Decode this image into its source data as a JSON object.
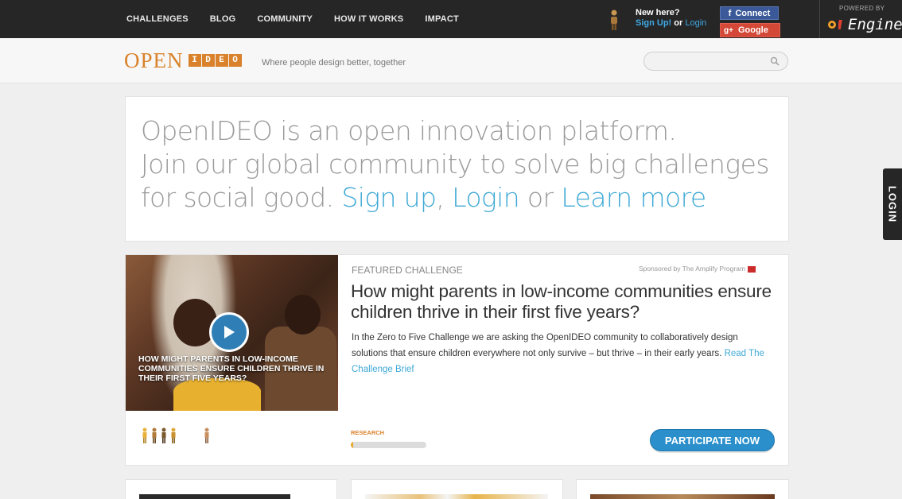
{
  "topnav": {
    "items": [
      "CHALLENGES",
      "BLOG",
      "COMMUNITY",
      "HOW IT WORKS",
      "IMPACT"
    ]
  },
  "account": {
    "new_here": "New here?",
    "signup": "Sign Up!",
    "or": "or",
    "login": "Login",
    "facebook": "Connect",
    "google": "Google"
  },
  "powered": {
    "label": "POWERED BY",
    "engine": "Engine"
  },
  "header": {
    "logo_open": "OPEN",
    "logo_ideo": [
      "I",
      "D",
      "E",
      "O"
    ],
    "tagline": "Where people design better, together",
    "search_placeholder": ""
  },
  "side_tab": {
    "label": "LOGIN"
  },
  "intro": {
    "line1": "OpenIDEO is an open innovation platform.",
    "line2": "Join our global community to solve big challenges",
    "line3_prefix": "for social good. ",
    "signup": "Sign up",
    "comma": ", ",
    "login": "Login",
    "or": " or ",
    "learn_more": "Learn more"
  },
  "featured": {
    "label": "FEATURED CHALLENGE",
    "sponsor": "Sponsored by The Amplify Program",
    "title": "How might parents in low-income communities ensure children thrive in their first five years?",
    "description": "In the Zero to Five Challenge we are asking the OpenIDEO community to collaboratively design solutions that ensure children everywhere not only survive – but thrive – in their early years.",
    "brief_link": "Read The Challenge Brief",
    "image_caption": "How might parents in low-income communities ensure children thrive in their first five years?",
    "phase": "RESEARCH",
    "phase_progress": 0.03,
    "participate": "PARTICIPATE NOW"
  },
  "colors": {
    "accent_blue": "#3fa9d6",
    "brand_orange": "#d9822b",
    "topbar": "#262626",
    "cta": "#2b8fcb"
  }
}
